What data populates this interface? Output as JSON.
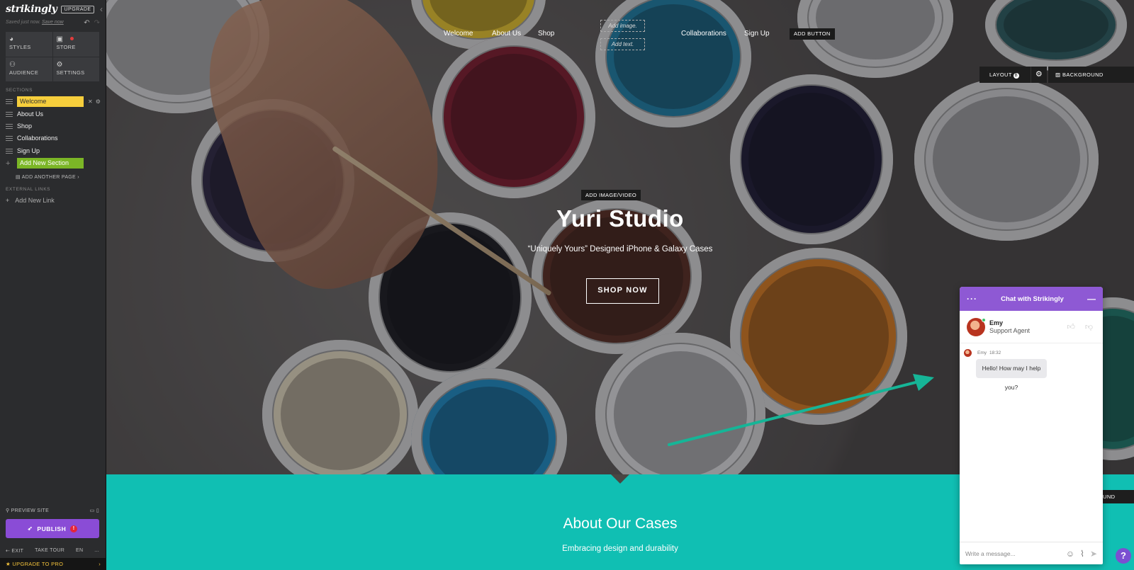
{
  "sidebar": {
    "logo": "strikingly",
    "upgrade_badge": "UPGRADE",
    "saved_text": "Saved just now.",
    "save_now": "Save now",
    "tools": [
      {
        "label": "STYLES",
        "icon": "palette-icon"
      },
      {
        "label": "STORE",
        "icon": "bag-icon"
      },
      {
        "label": "AUDIENCE",
        "icon": "people-icon"
      },
      {
        "label": "SETTINGS",
        "icon": "gear-icon"
      }
    ],
    "sections_title": "SECTIONS",
    "sections": [
      "Welcome",
      "About Us",
      "Shop",
      "Collaborations",
      "Sign Up"
    ],
    "add_new_section": "Add New Section",
    "add_another_page": "ADD ANOTHER PAGE",
    "external_links_title": "EXTERNAL LINKS",
    "add_new_link": "Add New Link",
    "preview_site": "PREVIEW SITE",
    "publish": "PUBLISH",
    "exit": "EXIT",
    "take_tour": "TAKE TOUR",
    "language": "EN",
    "more": "...",
    "upgrade_pro": "UPGRADE TO PRO"
  },
  "hero": {
    "nav": [
      "Welcome",
      "About Us",
      "Shop",
      "Collaborations",
      "Sign Up"
    ],
    "add_image": "Add image.",
    "add_text": "Add text.",
    "add_button": "ADD BUTTON",
    "layout": "LAYOUT",
    "layout_badge": "B",
    "background": "BACKGROUND",
    "add_media": "ADD IMAGE/VIDEO",
    "title": "Yuri Studio",
    "subtitle": "“Uniquely Yours” Designed iPhone & Galaxy Cases",
    "cta": "SHOP NOW"
  },
  "about": {
    "title": "About Our Cases",
    "subtitle": "Embracing design and durability",
    "background_partial": "ROUND"
  },
  "chat": {
    "header_title": "Chat with Strikingly",
    "agent_name": "Emy",
    "agent_role": "Support Agent",
    "message_author": "Emy",
    "message_time": "18:32",
    "message": "Hello! How may I help you?",
    "input_placeholder": "Write a message...",
    "help": "?"
  },
  "colors": {
    "sidebar_bg": "#2b2c2e",
    "active_section": "#f6ce3c",
    "add_section": "#7bb626",
    "publish": "#8a4cd6",
    "teal_section": "#10bfb3",
    "chat_header": "#8e59d4",
    "arrow": "#16b597"
  }
}
